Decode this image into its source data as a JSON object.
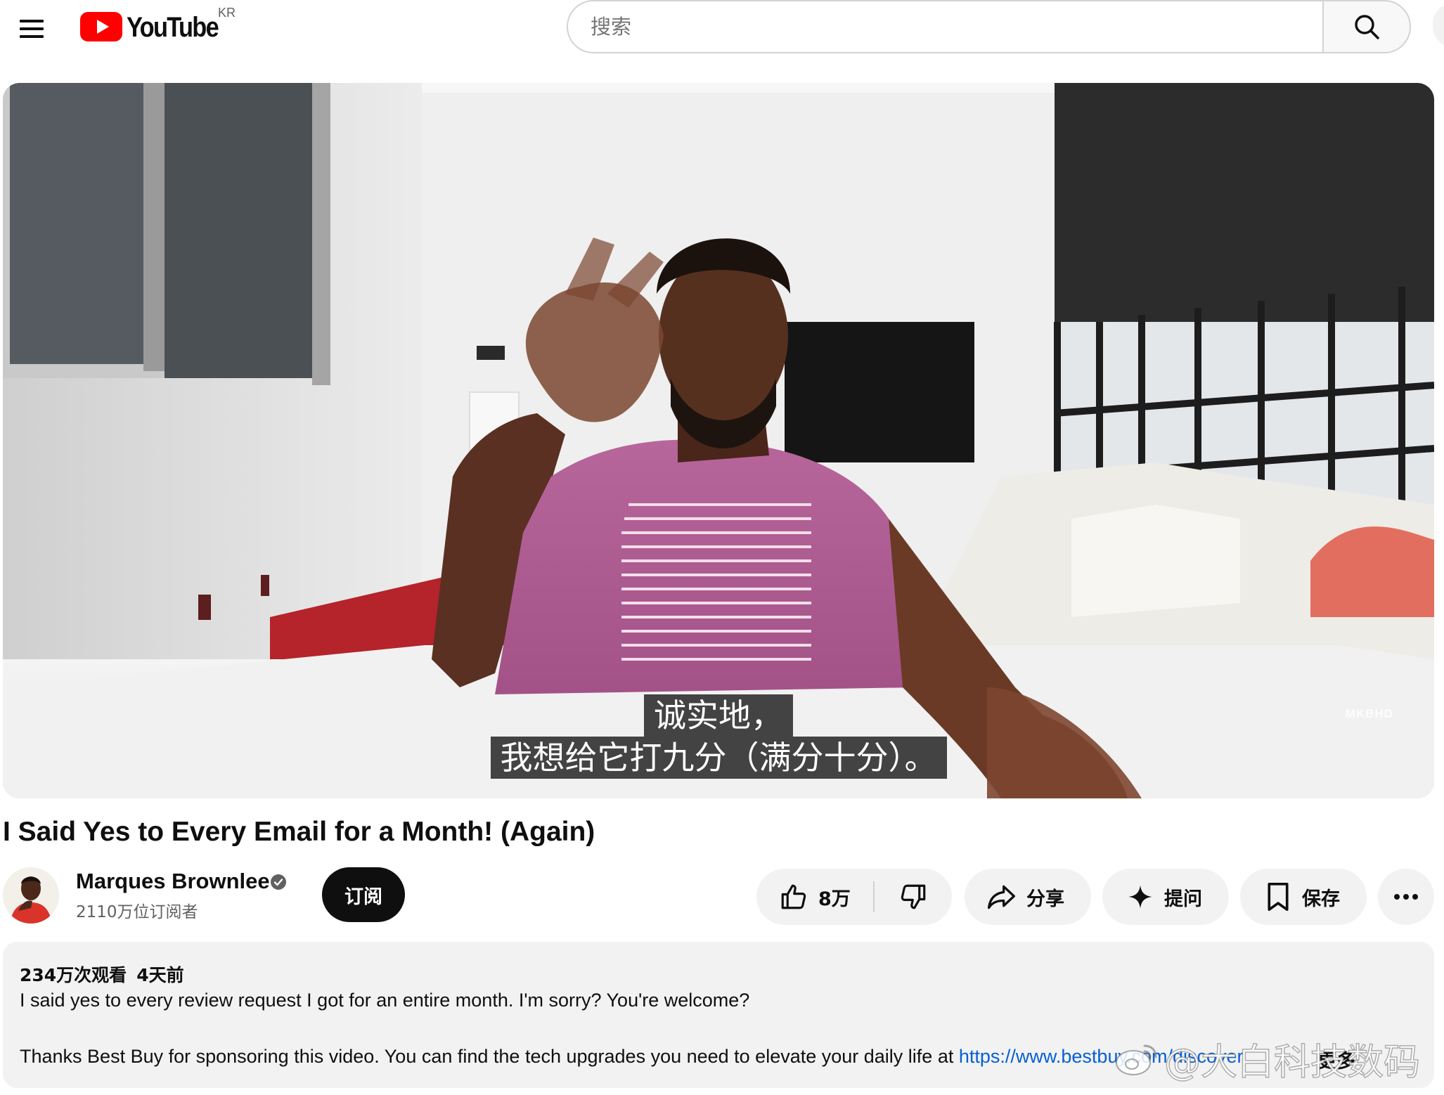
{
  "masthead": {
    "logo_text": "YouTube",
    "country_code": "KR",
    "search_placeholder": "搜索",
    "icons": [
      "menu-icon",
      "youtube-play-icon",
      "search-icon"
    ]
  },
  "player": {
    "captions": [
      "诚实地，",
      "我想给它打九分（满分十分）。"
    ],
    "corner_watermark": "MKBHD"
  },
  "video": {
    "title": "I Said Yes to Every Email for a Month! (Again)"
  },
  "owner": {
    "channel_name": "Marques Brownlee",
    "verified": true,
    "subscribers": "2110万位订阅者",
    "subscribe_label": "订阅"
  },
  "actions": {
    "like_count": "8万",
    "share_label": "分享",
    "ask_label": "提问",
    "save_label": "保存",
    "icons": [
      "thumbs-up-icon",
      "thumbs-down-icon",
      "share-arrow-icon",
      "sparkle-icon",
      "bookmark-icon",
      "more-horizontal-icon"
    ]
  },
  "description": {
    "views": "234万次观看",
    "published": "4天前",
    "line1": "I said yes to every review request I got for an entire month. I'm sorry? You're welcome?",
    "line2_text": "Thanks Best Buy for sponsoring this video. You can find the tech upgrades you need to elevate your daily life at ",
    "line2_link": "https://www.bestbuy.com/discover",
    "more_label": "更多"
  },
  "overlay_watermark": {
    "text": "@大白科技数码"
  },
  "colors": {
    "youtube_red": "#ff0000",
    "link_blue": "#065fd4",
    "pill_bg": "#f2f2f2",
    "subscribe_bg": "#0f0f0f"
  }
}
